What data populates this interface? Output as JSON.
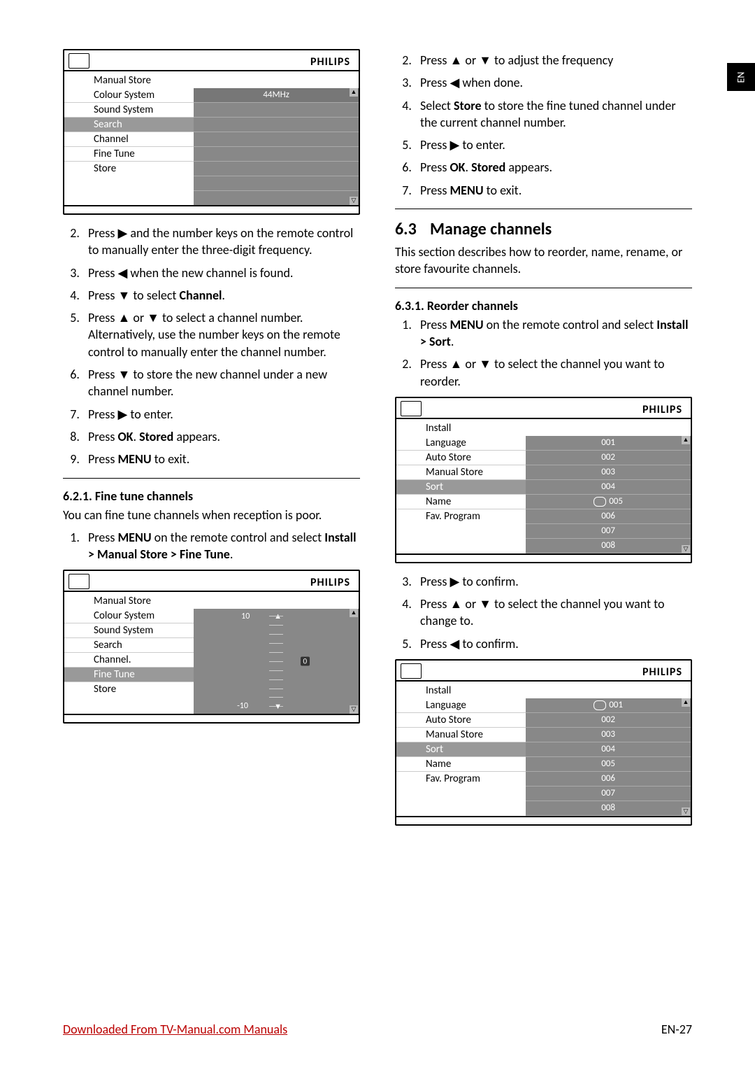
{
  "side_tab": "EN",
  "brand": "PHILIPS",
  "menu1": {
    "title": "Manual Store",
    "items": [
      "Colour System",
      "Sound System",
      "Search",
      "Channel",
      "Fine Tune",
      "Store"
    ],
    "selected_index": 2,
    "value": "44MHz"
  },
  "left_steps_A": [
    {
      "n": "2.",
      "t": "Press ▶ and the number keys on the remote control to manually enter the three-digit frequency."
    },
    {
      "n": "3.",
      "t": "Press ◀ when the new channel is found."
    },
    {
      "n": "4.",
      "t": "Press ▼ to select ",
      "b": "Channel",
      "t2": "."
    },
    {
      "n": "5.",
      "t": "Press ▲ or ▼ to select a channel number. Alternatively, use the number keys on the remote control to manually enter the channel number."
    },
    {
      "n": "6.",
      "t": "Press ▼ to store the new channel under a new channel number."
    },
    {
      "n": "7.",
      "t": "Press ▶ to enter."
    },
    {
      "n": "8.",
      "t": "Press ",
      "b": "OK",
      "t2": ". ",
      "b2": "Stored",
      "t3": " appears."
    },
    {
      "n": "9.",
      "t": "Press ",
      "b": "MENU",
      "t2": " to exit."
    }
  ],
  "sub_621": {
    "heading": "6.2.1.  Fine tune channels",
    "intro": "You can fine tune channels when reception is poor.",
    "steps": [
      {
        "n": "1.",
        "t": "Press ",
        "b": "MENU",
        "t2": " on the remote control and select ",
        "b2": "Install > Manual Store > Fine Tune",
        "t3": "."
      }
    ]
  },
  "menu2": {
    "title": "Manual Store",
    "items": [
      "Colour System",
      "Sound System",
      "Search",
      "Channel.",
      "Fine Tune",
      "Store"
    ],
    "selected_index": 4,
    "scale_top": "10",
    "scale_bot": "-10",
    "marker": "0"
  },
  "right_steps_A": [
    {
      "n": "2.",
      "t": "Press ▲ or ▼ to adjust the frequency"
    },
    {
      "n": "3.",
      "t": "Press ◀ when done."
    },
    {
      "n": "4.",
      "t": "Select ",
      "b": "Store",
      "t2": " to store the fine tuned channel under the current channel number."
    },
    {
      "n": "5.",
      "t": "Press ▶ to enter."
    },
    {
      "n": "6.",
      "t": "Press ",
      "b": "OK",
      "t2": ". ",
      "b2": "Stored",
      "t3": " appears."
    },
    {
      "n": "7.",
      "t": "Press ",
      "b": "MENU",
      "t2": " to exit."
    }
  ],
  "sec63": {
    "num": "6.3",
    "title": "Manage channels",
    "intro": "This section describes how to reorder, name, rename, or store favourite channels."
  },
  "sub_631": {
    "heading": "6.3.1.  Reorder channels",
    "steps_a": [
      {
        "n": "1.",
        "t": "Press ",
        "b": "MENU",
        "t2": " on the remote control and select ",
        "b2": "Install > Sort",
        "t3": "."
      },
      {
        "n": "2.",
        "t": "Press ▲ or ▼ to select the channel you want to reorder."
      }
    ],
    "steps_b": [
      {
        "n": "3.",
        "t": "Press ▶ to confirm."
      },
      {
        "n": "4.",
        "t": "Press ▲ or ▼ to select the channel you want to change to."
      },
      {
        "n": "5.",
        "t": "Press ◀ to confirm."
      }
    ]
  },
  "menu3": {
    "title": "Install",
    "items": [
      "Language",
      "Auto Store",
      "Manual Store",
      "Sort",
      "Name",
      "Fav. Program"
    ],
    "selected_index": 3,
    "values": [
      "001",
      "002",
      "003",
      "004",
      "005",
      "006",
      "007",
      "008"
    ],
    "marked_value_index": 4
  },
  "menu4": {
    "title": "Install",
    "items": [
      "Language",
      "Auto Store",
      "Manual Store",
      "Sort",
      "Name",
      "Fav. Program"
    ],
    "selected_index": 3,
    "values": [
      "001",
      "002",
      "003",
      "004",
      "005",
      "006",
      "007",
      "008"
    ],
    "marked_value_index": 0
  },
  "footer": {
    "left": "Downloaded From TV-Manual.com Manuals",
    "right": "EN-27"
  }
}
